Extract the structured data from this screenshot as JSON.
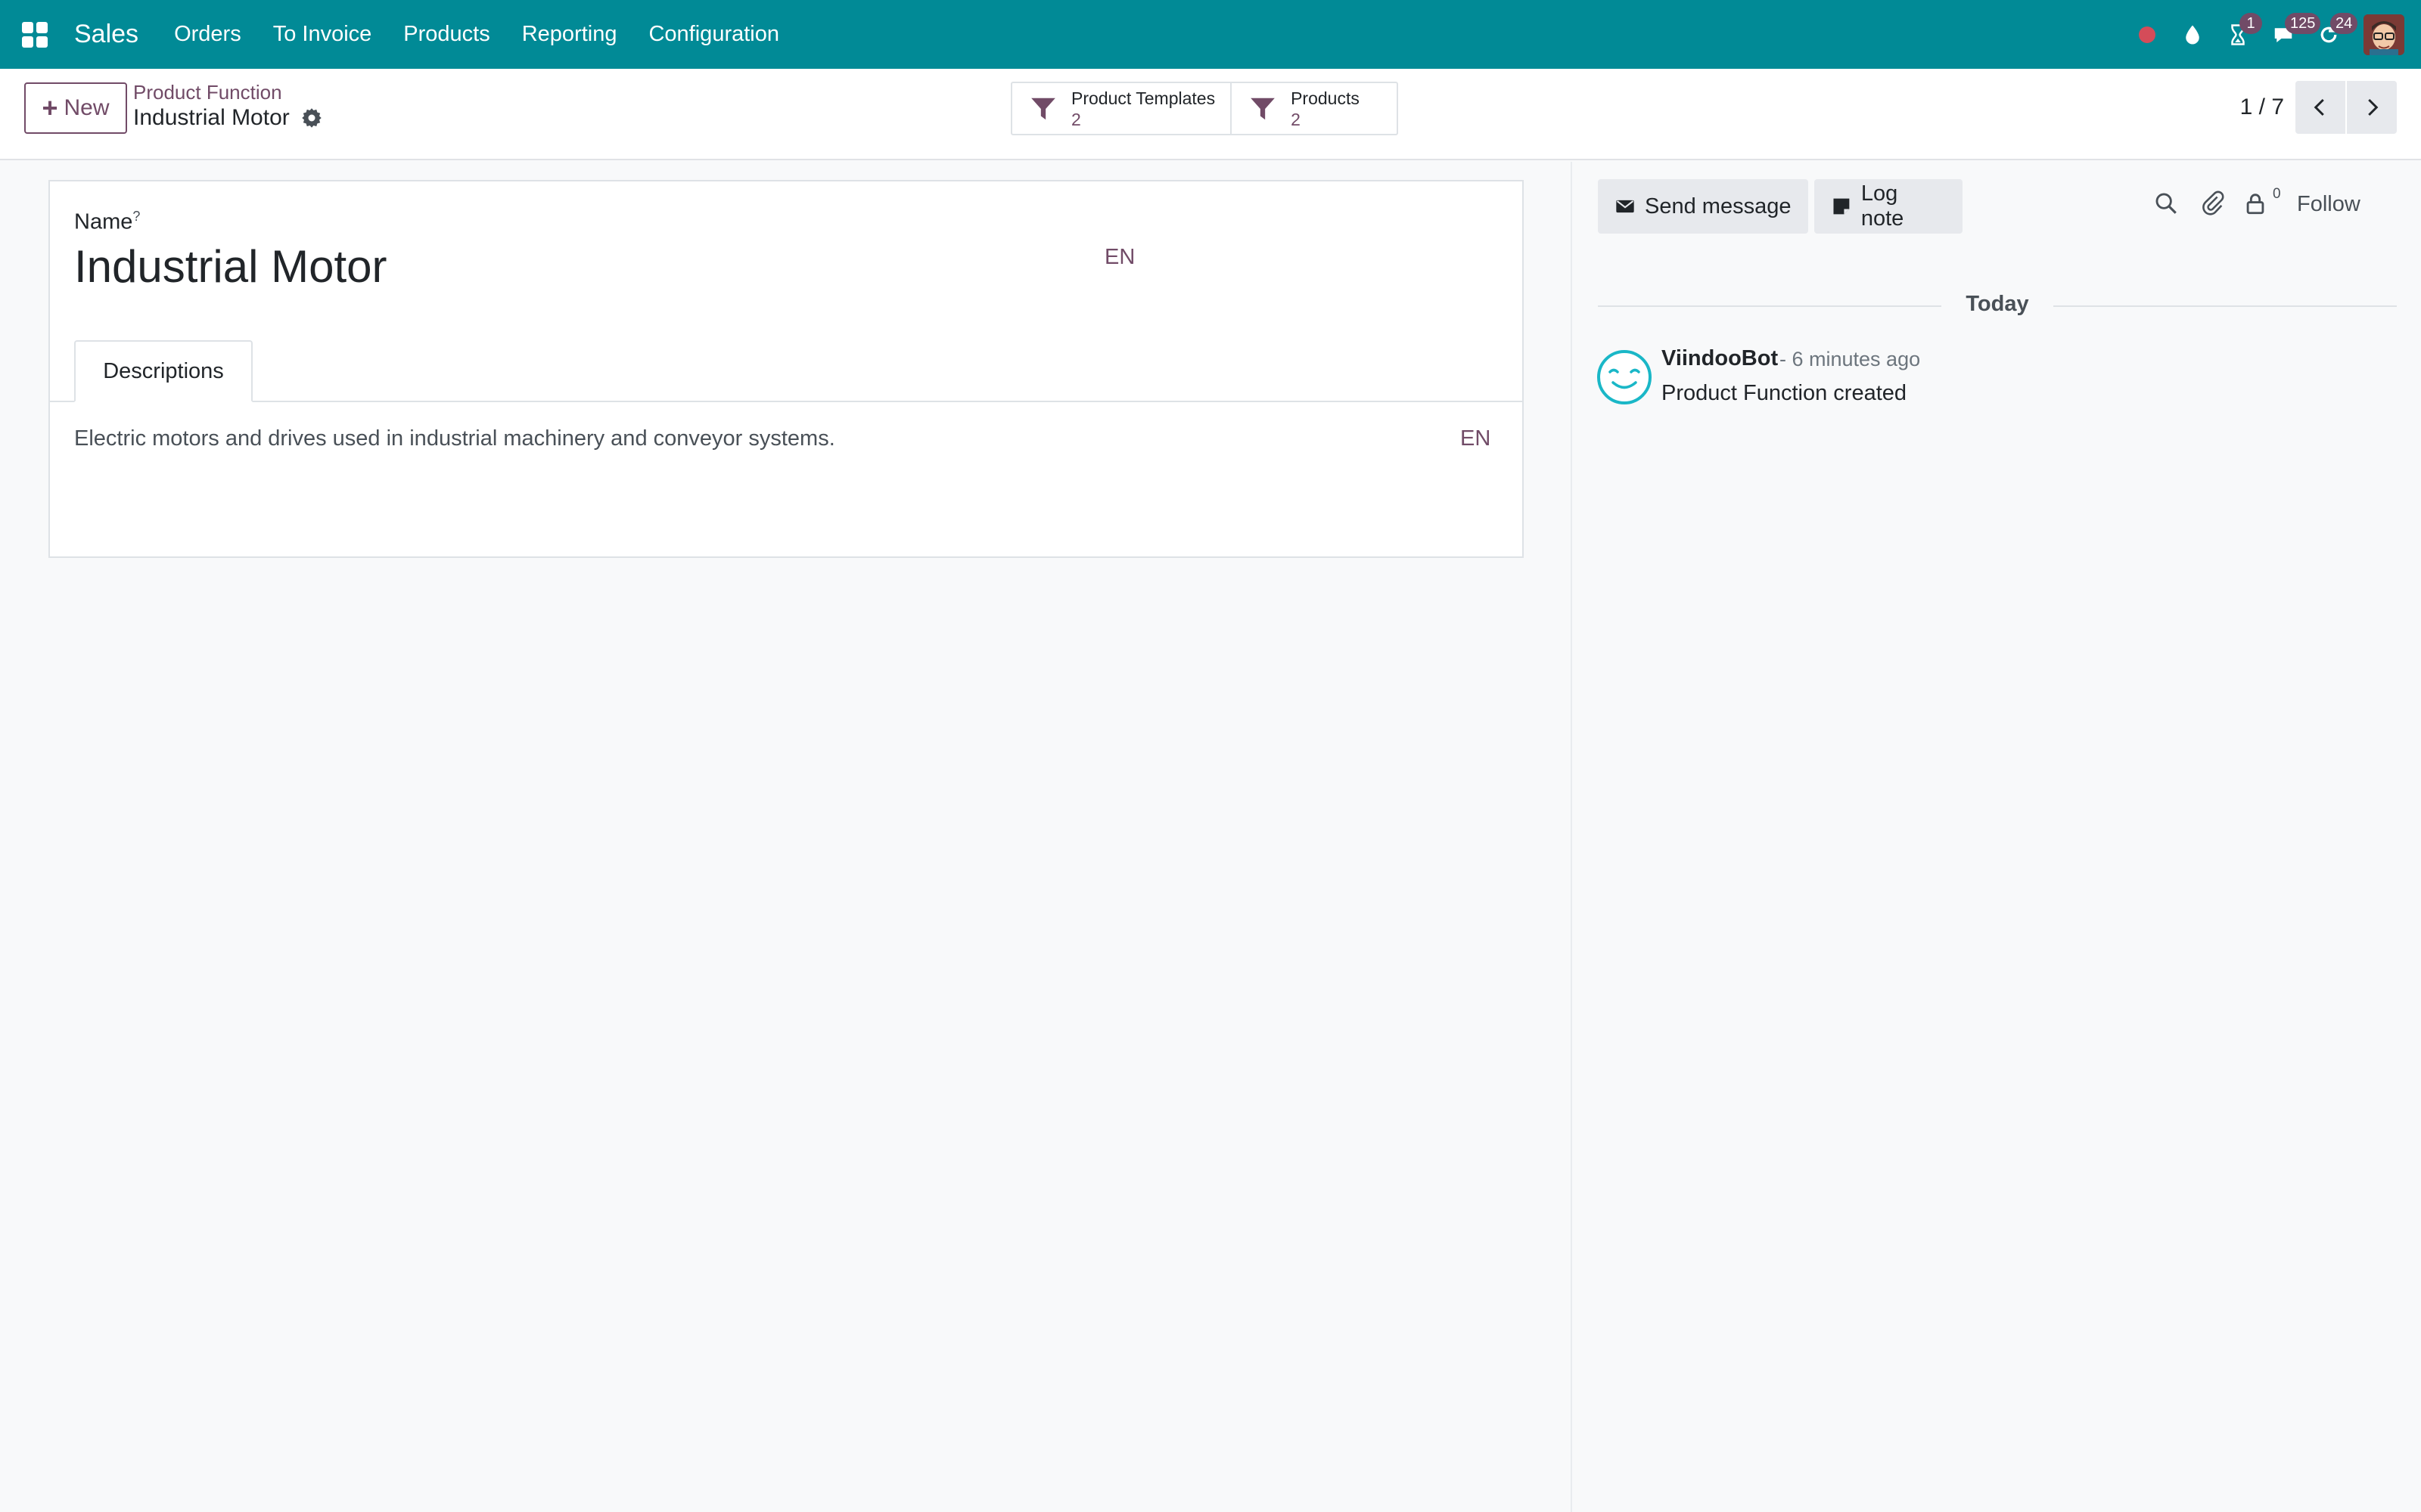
{
  "navbar": {
    "app_name": "Sales",
    "menu": [
      "Orders",
      "To Invoice",
      "Products",
      "Reporting",
      "Configuration"
    ],
    "badges": {
      "activities": "1",
      "messages": "125",
      "updates": "24"
    },
    "icons": [
      "recording-dot-icon",
      "droplet-icon",
      "hourglass-icon",
      "chat-icon",
      "refresh-icon",
      "user-avatar"
    ],
    "color": "#018a96"
  },
  "control_panel": {
    "new_label": "New",
    "breadcrumb_parent": "Product Function",
    "breadcrumb_current": "Industrial Motor",
    "smart_buttons": [
      {
        "label": "Product Templates",
        "value": "2"
      },
      {
        "label": "Products",
        "value": "2"
      }
    ],
    "pager": "1 / 7"
  },
  "form": {
    "name_label": "Name",
    "help_mark": "?",
    "name_value": "Industrial Motor",
    "lang": "EN",
    "tab_label": "Descriptions",
    "description": "Electric motors and drives used in industrial machinery and conveyor systems."
  },
  "chatter": {
    "send_message": "Send message",
    "log_note": "Log note",
    "followers_count": "0",
    "follow": "Follow",
    "date_separator": "Today",
    "message": {
      "author": "ViindooBot",
      "time": "- 6 minutes ago",
      "body": "Product Function created"
    }
  },
  "colors": {
    "primary": "#714b67",
    "navbar": "#018a96",
    "bot_avatar": "#1ab7c7"
  }
}
